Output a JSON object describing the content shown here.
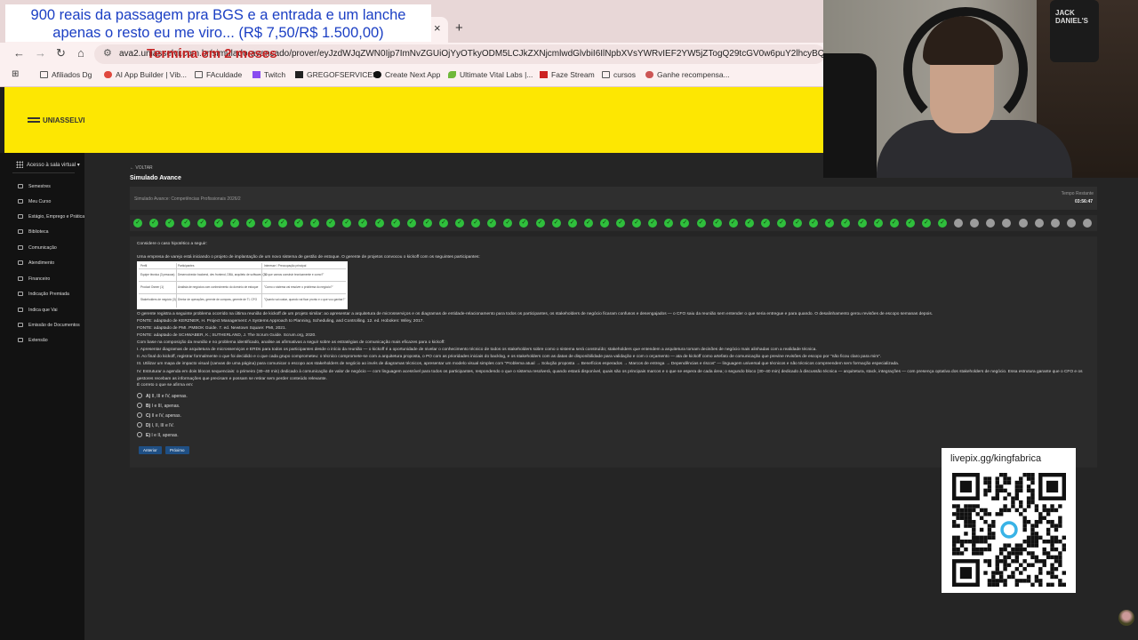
{
  "browser": {
    "tab_close_icon": "×",
    "new_tab_icon": "+",
    "url": "ava2.uniasselvi.com.br/simulado-avancado/prover/eyJzdWJqZWN0Ijp7ImNvZGUiOjYyOTkyODM5LCJkZXNjcmlwdGlvbiI6IlNpbXVsYWRvIEF2YW5jZTogQ29tcGV0w6puY2lhcyBQcm9maXNzaW9uYWlz",
    "bookmarks": [
      "Afiliados Dg",
      "AI App Builder | Vib...",
      "FAculdade",
      "Twitch",
      "GREGOFSERVICES",
      "Create Next App",
      "Ultimate Vital Labs |...",
      "Faze Stream",
      "cursos",
      "Ganhe recompensa..."
    ]
  },
  "overlay": {
    "donation_line1": "900 reais da passagem pra BGS e a entrada e um lanche",
    "donation_line2": "apenas o resto eu me viro... (R$ 7,50/R$ 1.500,00)",
    "promo": "Termina em 2 meses",
    "qr_label": "livepix.gg/kingfabrica",
    "webcam_bottle": "JACK DANIEL'S"
  },
  "site": {
    "logo": "UNIASSELVI",
    "sidebar_head": "Acesso à sala virtual",
    "sidebar_items": [
      "Semestres",
      "Meu Curso",
      "Estágio, Emprego e Práticas",
      "Biblioteca",
      "Comunicação",
      "Atendimento",
      "Financeiro",
      "Indicação Premiada",
      "Indica que Vai",
      "Emissão de Documentos",
      "Extensão"
    ],
    "back": "← VOLTAR",
    "title": "Simulado Avance",
    "exam_name": "Simulado Avance: Competências Profissionais 2026/2",
    "timer_label": "Tempo Restante",
    "timer_value": "03:56:47",
    "progress": {
      "done": 51,
      "total": 60
    }
  },
  "question": {
    "intro": "Considere o caso hipotético a seguir:",
    "p1": "Uma empresa de varejo está iniciando o projeto de implantação de um novo sistema de gestão de estoque. O gerente de projetos convocou o kickoff com os seguintes participantes:",
    "table": {
      "headers": [
        "Perfil",
        "Participantes",
        "Interesse / Preocupação principal"
      ],
      "rows": [
        [
          "Equipe técnica (3 pessoas)",
          "Desenvolvedor backend, dev frontend, DBA, arquiteto de software, QA",
          "\"O que vamos construir tecnicamente e como?\""
        ],
        [
          "Product Owner (1)",
          "Analista de negócios com conhecimento do domínio de estoque",
          "\"Como o sistema vai resolver o problema do negócio?\""
        ],
        [
          "Stakeholders de negócio (3)",
          "Diretor de operações, gerente de compras, gerente de TI, CFO",
          "\"Quanto vai custar, quando vai ficar pronto e o que vou ganhar?\""
        ]
      ]
    },
    "p2": "O gerente registra a seguinte problema ocorrido na última reunião de kickoff de um projeto similar: ao apresentar a arquitetura de microsserviços e os diagramas de entidade-relacionamento para todos os participantes, os stakeholders de negócio ficaram confusos e desengajados — o CFO saiu da reunião sem entender o que seria entregue e para quando. O desalinhamento gerou revisões de escopo semanas depois.",
    "src1": "FONTE: adaptado de KERZNER, H. Project Management: A Systems Approach to Planning, Scheduling, and Controlling. 12. ed. Hoboken: Wiley, 2017.",
    "src2": "FONTE: adaptado de PMI. PMBOK Guide. 7. ed. Newtown Square: PMI, 2021.",
    "src3": "FONTE: adaptado de SCHWABER, K.; SUTHERLAND, J. The Scrum Guide. Scrum.org, 2020.",
    "lead": "Com base na composição da reunião e no problema identificado, analise as afirmativas a seguir sobre as estratégias de comunicação mais eficazes para o kickoff:",
    "s1": "I. Apresentar diagramas de arquitetura de microsserviços e ERDs para todos os participantes desde o início da reunião — o kickoff é a oportunidade de nivelar o conhecimento técnico de todos os stakeholders sobre como o sistema será construído; stakeholders que entendem a arquitetura tomam decisões de negócio mais alinhadas com a realidade técnica.",
    "s2": "II. Ao final do kickoff, registrar formalmente o que foi decidido e o que cada grupo comprometeu: o técnico compromete-se com a arquitetura proposta, o PO com as prioridades iniciais do backlog, e os stakeholders com as datas de disponibilidade para validação e com o orçamento — ata de kickoff como artefato de comunicação que previne revisões de escopo por \"não ficou claro para mim\".",
    "s3": "III. Utilizar um mapa de impacto visual (canvas de uma página) para comunicar o escopo aos stakeholders de negócio ao invés de diagramas técnicos, apresentar um modelo visual simples com \"Problema atual → Solução proposta → Benefícios esperados → Marcos de entrega → Dependências e riscos\" — linguagem universal que técnicos e não técnicos compreendem sem formação especializada.",
    "s4": "IV. Estruturar a agenda em dois blocos sequenciais: o primeiro (30–40 min) dedicado à comunicação de valor de negócio — com linguagem acessível para todos os participantes, respondendo o que o sistema resolverá, quando estará disponível, quais são os principais marcos e o que se espera de cada área; o segundo bloco (30–40 min) dedicado à discussão técnica — arquitetura, stack, integrações — com presença optativa dos stakeholders de negócio. Essa estrutura garante que o CFO e os gestores recebam as informações que precisam e possam se retirar sem perder conteúdo relevante.",
    "ask": "É correto o que se afirma em:",
    "options": [
      {
        "letter": "A)",
        "text": "II, III e IV, apenas."
      },
      {
        "letter": "B)",
        "text": "I e III, apenas."
      },
      {
        "letter": "C)",
        "text": "II e IV, apenas."
      },
      {
        "letter": "D)",
        "text": "I, II, III e IV."
      },
      {
        "letter": "E)",
        "text": "I e II, apenas."
      }
    ],
    "btn_prev": "Anterior",
    "btn_next": "Próximo"
  }
}
